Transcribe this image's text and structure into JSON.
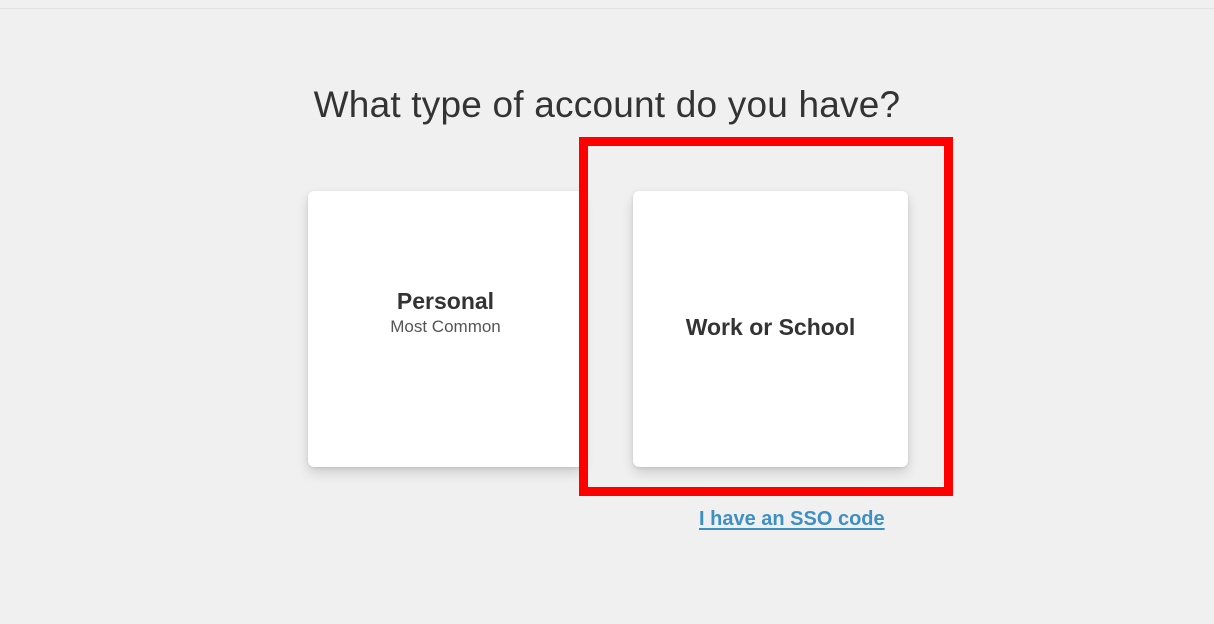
{
  "page": {
    "title": "What type of account do you have?"
  },
  "account_options": [
    {
      "title": "Personal",
      "subtitle": "Most Common"
    },
    {
      "title": "Work or School"
    }
  ],
  "sso": {
    "link_label": "I have an SSO code"
  },
  "colors": {
    "background": "#f0f0f0",
    "card": "#ffffff",
    "text": "#333333",
    "link": "#3d8fc4",
    "highlight": "#ff0000"
  }
}
